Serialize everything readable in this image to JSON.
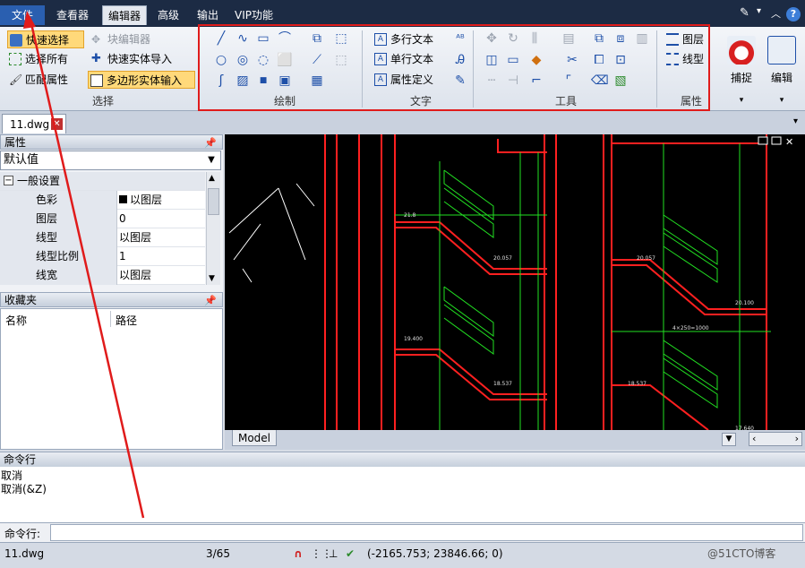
{
  "menubar": {
    "tabs": [
      {
        "label": "文件"
      },
      {
        "label": "查看器"
      },
      {
        "label": "编辑器"
      },
      {
        "label": "高级"
      },
      {
        "label": "输出"
      },
      {
        "label": "VIP功能"
      }
    ],
    "active_tab": "编辑器"
  },
  "ribbon": {
    "select_group": {
      "label": "选择",
      "buttons": [
        {
          "label": "快速选择"
        },
        {
          "label": "块编辑器"
        },
        {
          "label": "选择所有"
        },
        {
          "label": "快速实体导入"
        },
        {
          "label": "匹配属性"
        },
        {
          "label": "多边形实体输入"
        }
      ]
    },
    "draw_group": {
      "label": "绘制"
    },
    "text_group": {
      "label": "文字",
      "buttons": [
        {
          "label": "多行文本"
        },
        {
          "label": "单行文本"
        },
        {
          "label": "属性定义"
        }
      ]
    },
    "tools_group": {
      "label": "工具"
    },
    "props_group": {
      "label": "属性",
      "buttons": [
        {
          "label": "图层"
        },
        {
          "label": "线型"
        }
      ]
    },
    "snap_button": {
      "label": "捕捉"
    },
    "edit_button": {
      "label": "编辑"
    }
  },
  "document": {
    "tab_name": "11.dwg",
    "layout_tab": "Model"
  },
  "properties_panel": {
    "title": "属性",
    "combo_value": "默认值",
    "section": "一般设置",
    "rows": [
      {
        "name": "色彩",
        "value": "以图层"
      },
      {
        "name": "图层",
        "value": "0"
      },
      {
        "name": "线型",
        "value": "以图层"
      },
      {
        "name": "线型比例",
        "value": "1"
      },
      {
        "name": "线宽",
        "value": "以图层"
      }
    ]
  },
  "favorites_panel": {
    "title": "收藏夹",
    "columns": [
      "名称",
      "路径"
    ]
  },
  "command": {
    "header": "命令行",
    "log": [
      "取消",
      "取消(&Z)"
    ],
    "input_label": "命令行:"
  },
  "statusbar": {
    "file": "11.dwg",
    "page": "3/65",
    "coords": "(-2165.753; 23846.66; 0)",
    "watermark": "@51CTO博客"
  },
  "colors": {
    "menubar_bg": "#1c2b44",
    "highlight_box": "#e01b1b",
    "canvas_bg": "#000000",
    "cad_red": "#ff2020",
    "cad_green": "#22e022"
  }
}
